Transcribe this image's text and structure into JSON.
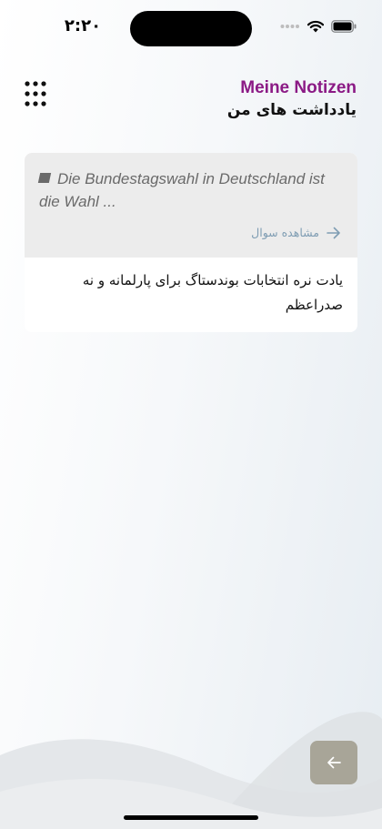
{
  "status_bar": {
    "time": "۲:۲۰"
  },
  "header": {
    "title_de": "Meine Notizen",
    "title_fa": "یادداشت های من"
  },
  "note": {
    "question_text": "Die Bundestagswahl in Deutschland ist die Wahl ...",
    "view_question_label": "مشاهده سوال",
    "note_text": "یادت نره انتخابات بوندستاگ برای پارلمانه و نه صدراعظم"
  },
  "colors": {
    "title_accent": "#8b1a85",
    "link": "#7f9db3",
    "question_bg": "#ececec",
    "back_button": "#a8a598"
  },
  "icons": {
    "menu": "grid-dots-icon",
    "view_question": "arrow-right-icon",
    "back": "arrow-left-icon"
  }
}
